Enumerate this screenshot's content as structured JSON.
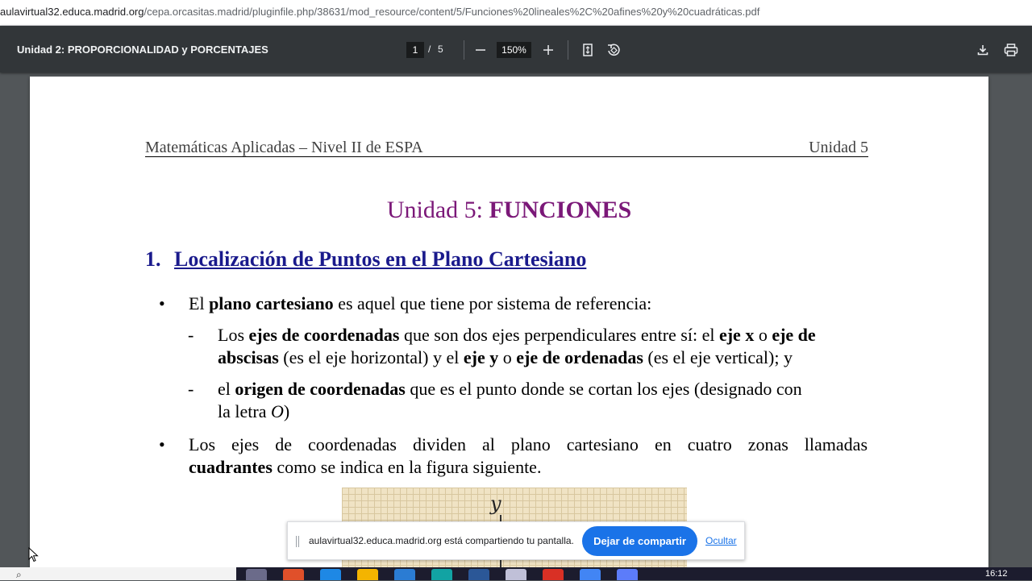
{
  "browser": {
    "url_host": "aulavirtual32.educa.madrid.org",
    "url_path": "/cepa.orcasitas.madrid/pluginfile.php/38631/mod_resource/content/5/Funciones%20lineales%2C%20afines%20y%20cuadráticas.pdf"
  },
  "toolbar": {
    "title": "Unidad 2: PROPORCIONALIDAD y PORCENTAJES",
    "page_current": "1",
    "page_sep": "/",
    "page_total": "5",
    "zoom": "150%",
    "icons": [
      "zoom-out-icon",
      "zoom-in-icon",
      "fit-page-icon",
      "rotate-icon",
      "download-icon",
      "print-icon"
    ]
  },
  "document": {
    "header_left": "Matemáticas Aplicadas – Nivel II de ESPA",
    "header_right": "Unidad 5",
    "unit_title_prefix": "Unidad 5: ",
    "unit_title_bold": "FUNCIONES",
    "section_number": "1.",
    "section_title": "Localización de Puntos en el Plano Cartesiano",
    "bullet1": {
      "t1": "El ",
      "b1": "plano cartesiano",
      "t2": " es aquel que tiene por sistema de referencia:"
    },
    "dash1": {
      "l1_t1": "Los ",
      "l1_b1": "ejes de coordenadas",
      "l1_t2": " que son dos ejes perpendiculares entre sí: el ",
      "l1_b2": "eje x",
      "l1_t3": " o ",
      "l1_b3": "eje de",
      "l2_b1": "abscisas",
      "l2_t1": " (es el eje horizontal) y el ",
      "l2_b2": "eje y",
      "l2_t2": " o ",
      "l2_b3": "eje de ordenadas",
      "l2_t3": " (es el eje vertical); y"
    },
    "dash2": {
      "l1_t1": "el ",
      "l1_b1": "origen de coordenadas",
      "l1_t2": " que es el punto donde se cortan los ejes (designado con",
      "l2_t1": "la letra ",
      "l2_i1": "O",
      "l2_t2": ")"
    },
    "bullet2": {
      "l1": "Los ejes de coordenadas dividen al plano cartesiano en cuatro zonas llamadas",
      "l2_b1": "cuadrantes",
      "l2_t1": " como se indica en la figura siguiente."
    },
    "figure_label": "y"
  },
  "sharebar": {
    "message": "aulavirtual32.educa.madrid.org está compartiendo tu pantalla.",
    "stop_label": "Dejar de compartir",
    "hide_label": "Ocultar"
  },
  "taskbar": {
    "clock": "16:12",
    "app_colors": [
      "#6b6b8a",
      "#e0502a",
      "#1e88e5",
      "#f4b400",
      "#2b7cd3",
      "#12a3a3",
      "#2b5797",
      "#c0c0d8",
      "#d93025",
      "#4285f4",
      "#5c7cfa"
    ]
  }
}
